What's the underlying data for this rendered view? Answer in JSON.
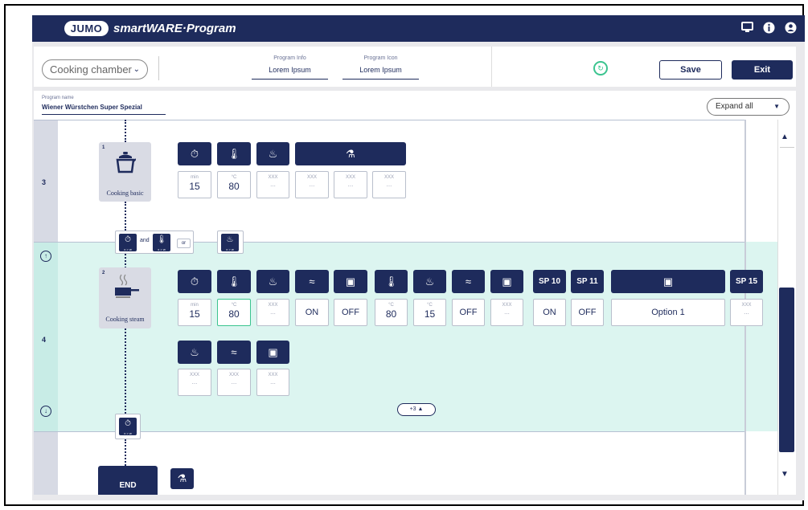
{
  "app": {
    "logo": "JUMO",
    "title": "smartWARE·Program"
  },
  "topbar_icons": [
    "monitor-icon",
    "info-icon",
    "user-icon"
  ],
  "toolbar": {
    "chamber": "Cooking chamber",
    "program_info_label": "Program Info",
    "program_info_value": "Lorem Ipsum",
    "program_icon_label": "Program Icon",
    "program_icon_value": "Lorem Ipsum",
    "save_label": "Save",
    "exit_label": "Exit"
  },
  "program": {
    "name_label": "Program name",
    "name_value": "Wiener Würstchen Super Spezial",
    "expand_label": "Expand all"
  },
  "rows": {
    "row3": {
      "label": "3",
      "step_num": "1",
      "step_name": "Cooking basic",
      "cells": [
        {
          "unit": "min",
          "value": "15"
        },
        {
          "unit": "°C",
          "value": "80"
        },
        {
          "unit": "XXX",
          "value": "..."
        },
        {
          "unit": "XXX",
          "value": "..."
        },
        {
          "unit": "XXX",
          "value": "..."
        },
        {
          "unit": "XXX",
          "value": "..."
        }
      ]
    },
    "conditions": {
      "and_label": "and",
      "or_label": "or",
      "sub": "x > w"
    },
    "row4": {
      "label": "4",
      "step_num": "2",
      "step_name": "Cooking steam",
      "headers_sp": [
        "SP 10",
        "SP 11",
        "SP 15"
      ],
      "cells": [
        {
          "unit": "min",
          "value": "15"
        },
        {
          "unit": "°C",
          "value": "80"
        },
        {
          "unit": "XXX",
          "value": "..."
        },
        {
          "value": "ON"
        },
        {
          "value": "OFF"
        },
        {
          "unit": "°C",
          "value": "80"
        },
        {
          "unit": "°C",
          "value": "15"
        },
        {
          "value": "OFF"
        },
        {
          "unit": "XXX",
          "value": "..."
        },
        {
          "value": "ON"
        },
        {
          "value": "OFF"
        },
        {
          "value": "Option 1"
        },
        {
          "unit": "XXX",
          "value": "..."
        }
      ],
      "cells2": [
        {
          "unit": "XXX",
          "value": "..."
        },
        {
          "unit": "XXX",
          "value": "..."
        },
        {
          "unit": "XXX",
          "value": "..."
        }
      ],
      "more_label": "+3 ▲"
    },
    "end_label": "END"
  },
  "colors": {
    "primary": "#1e2b5c",
    "band": "#dcf5f0",
    "sync": "#3bc48f"
  }
}
